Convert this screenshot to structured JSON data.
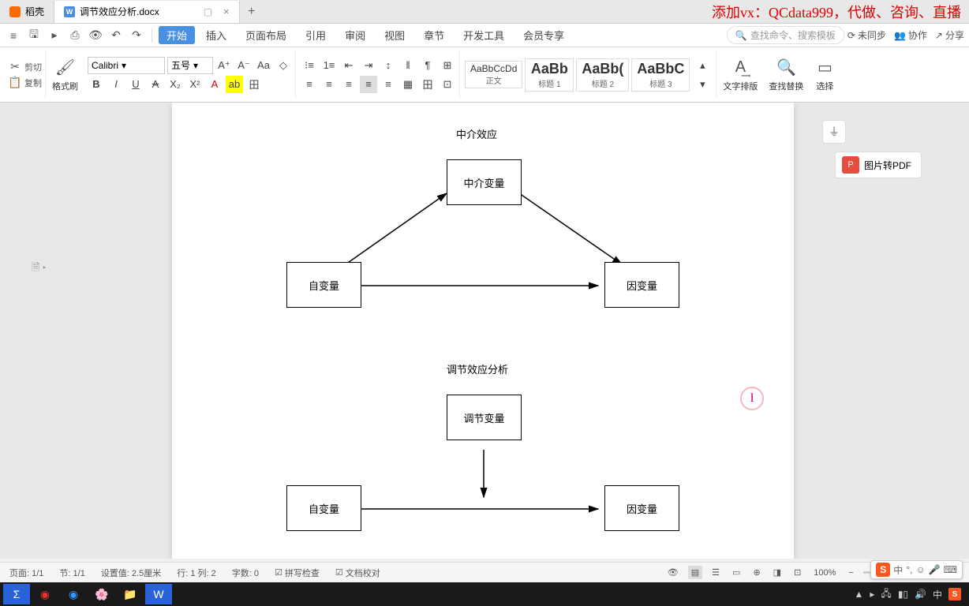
{
  "tabs": {
    "t1": "稻壳",
    "t2": "调节效应分析.docx",
    "add": "+"
  },
  "watermark": "添加vx：QCdata999，代做、咨询、直播",
  "ribbon_tabs": [
    "开始",
    "插入",
    "页面布局",
    "引用",
    "审阅",
    "视图",
    "章节",
    "开发工具",
    "会员专享"
  ],
  "search_ph": "查找命令、搜索模板",
  "topright": {
    "sync": "未同步",
    "coop": "协作",
    "share": "分享"
  },
  "clip": {
    "cut": "剪切",
    "copy": "复制",
    "brush": "格式刷"
  },
  "font": {
    "name": "Calibri",
    "size": "五号"
  },
  "styles": [
    {
      "p": "AaBbCcDd",
      "n": "正文"
    },
    {
      "p": "AaBb",
      "n": "标题 1"
    },
    {
      "p": "AaBb(",
      "n": "标题 2"
    },
    {
      "p": "AaBbC",
      "n": "标题 3"
    }
  ],
  "rtools": {
    "typeset": "文字排版",
    "find": "查找替换",
    "select": "选择"
  },
  "side": {
    "pdf": "图片转PDF"
  },
  "doc": {
    "t1": "中介效应",
    "b1a": "中介变量",
    "b1b": "自变量",
    "b1c": "因变量",
    "t2": "调节效应分析",
    "b2a": "调节变量",
    "b2b": "自变量",
    "b2c": "因变量"
  },
  "status": {
    "page": "页面: 1/1",
    "sec": "节: 1/1",
    "set": "设置值: 2.5厘米",
    "rc": "行: 1  列: 2",
    "wc": "字数: 0",
    "spell": "拼写检查",
    "proof": "文档校对",
    "zoom": "100%"
  },
  "ime": {
    "zh": "中",
    "sym": "°,",
    "pin": "◉"
  }
}
